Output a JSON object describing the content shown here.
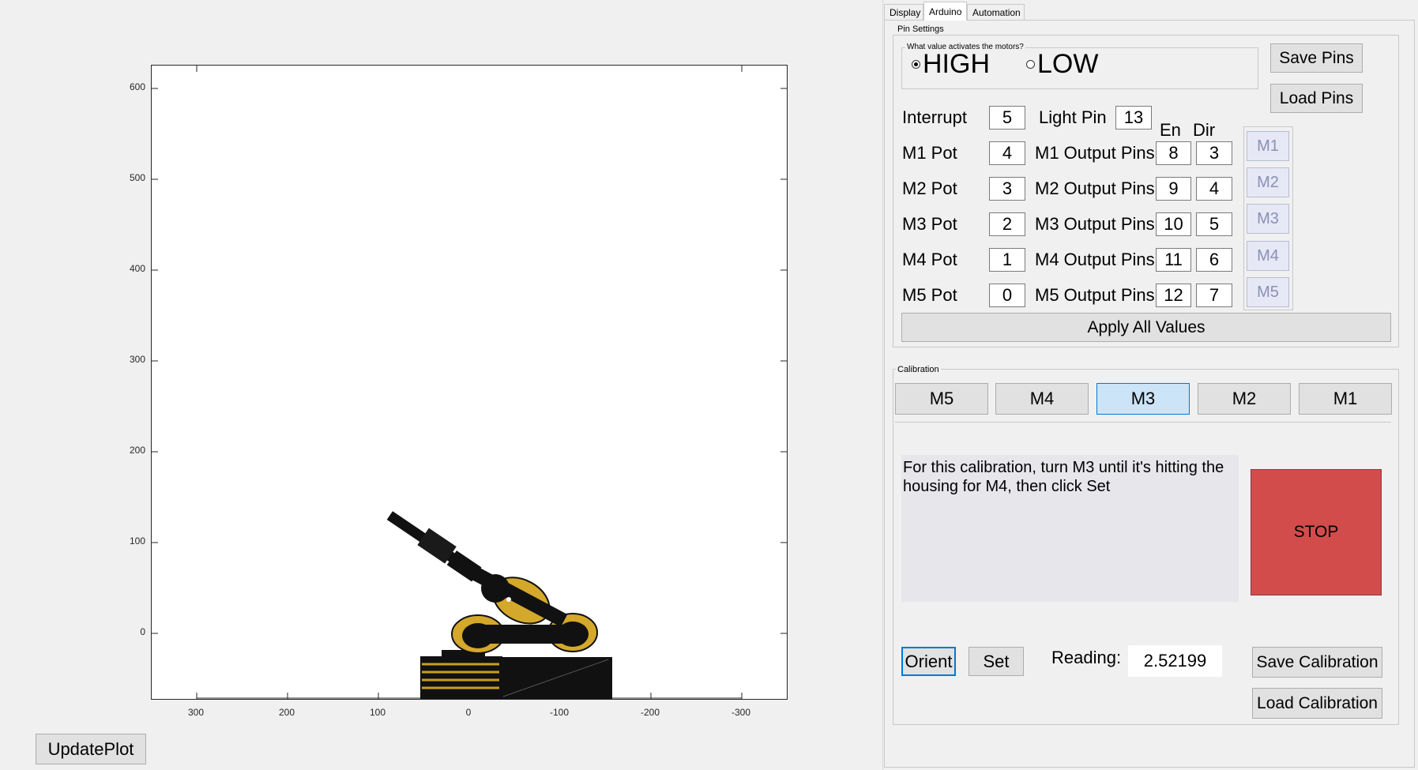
{
  "plot": {
    "y_ticks": [
      "600",
      "500",
      "400",
      "300",
      "200",
      "100",
      "0"
    ],
    "x_ticks": [
      "300",
      "200",
      "100",
      "0",
      "-100",
      "-200",
      "-300"
    ],
    "update_label": "UpdatePlot"
  },
  "tabs": [
    "Display",
    "Arduino",
    "Automation"
  ],
  "pins": {
    "title": "Pin Settings",
    "motors_question": "What value activates the motors?",
    "high_label": "HIGH",
    "low_label": "LOW",
    "selected": "HIGH",
    "save_label": "Save Pins",
    "load_label": "Load Pins",
    "interrupt_label": "Interrupt",
    "interrupt_value": "5",
    "light_label": "Light Pin",
    "light_value": "13",
    "en_header": "En",
    "dir_header": "Dir",
    "motors": [
      {
        "pot_label": "M1 Pot",
        "pot": "4",
        "out_label": "M1 Output Pins",
        "en": "8",
        "dir": "3",
        "btn": "M1"
      },
      {
        "pot_label": "M2 Pot",
        "pot": "3",
        "out_label": "M2 Output Pins",
        "en": "9",
        "dir": "4",
        "btn": "M2"
      },
      {
        "pot_label": "M3 Pot",
        "pot": "2",
        "out_label": "M3 Output Pins",
        "en": "10",
        "dir": "5",
        "btn": "M3"
      },
      {
        "pot_label": "M4 Pot",
        "pot": "1",
        "out_label": "M4 Output Pins",
        "en": "11",
        "dir": "6",
        "btn": "M4"
      },
      {
        "pot_label": "M5 Pot",
        "pot": "0",
        "out_label": "M5 Output Pins",
        "en": "12",
        "dir": "7",
        "btn": "M5"
      }
    ],
    "apply_label": "Apply All Values"
  },
  "calibration": {
    "title": "Calibration",
    "tabs": [
      "M5",
      "M4",
      "M3",
      "M2",
      "M1"
    ],
    "selected_tab": "M3",
    "instructions": "For this calibration, turn M3 until it's hitting the housing for M4, then click Set",
    "stop_label": "STOP",
    "stop_color": "#d24c4c",
    "orient_label": "Orient",
    "set_label": "Set",
    "reading_label": "Reading:",
    "reading_value": "2.52199",
    "save_label": "Save Calibration",
    "load_label": "Load Calibration"
  }
}
